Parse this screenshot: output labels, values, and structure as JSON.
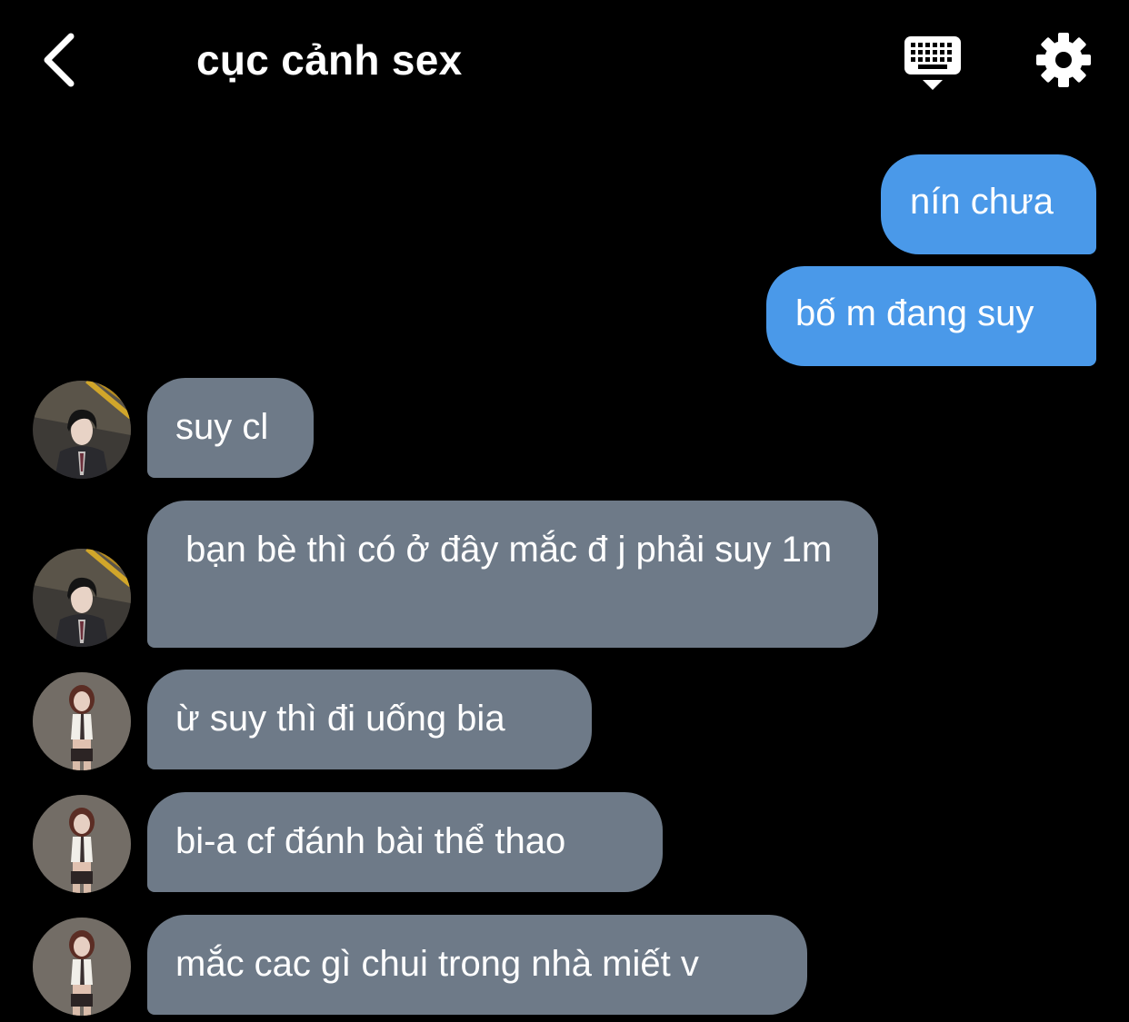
{
  "header": {
    "title": "cục cảnh sex",
    "back_icon": "chevron-left-icon",
    "keyboard_icon": "keyboard-dismiss-icon",
    "settings_icon": "gear-icon"
  },
  "colors": {
    "background": "#000000",
    "outgoing_bubble": "#4a99e9",
    "incoming_bubble": "#6e7a88",
    "text": "#ffffff"
  },
  "messages": [
    {
      "direction": "outgoing",
      "text": "nín chưa"
    },
    {
      "direction": "outgoing",
      "text": "bố m đang suy"
    },
    {
      "direction": "incoming",
      "sender": "male-avatar",
      "text": "suy cl"
    },
    {
      "direction": "incoming",
      "sender": "male-avatar",
      "text": " bạn bè thì có ở đây mắc đ j phải suy 1m"
    },
    {
      "direction": "incoming",
      "sender": "female-avatar",
      "text": "ừ suy thì đi uống bia"
    },
    {
      "direction": "incoming",
      "sender": "female-avatar",
      "text": "bi-a cf đánh bài thể thao"
    },
    {
      "direction": "incoming",
      "sender": "female-avatar",
      "text": "mắc cac gì chui trong nhà miết v"
    }
  ]
}
